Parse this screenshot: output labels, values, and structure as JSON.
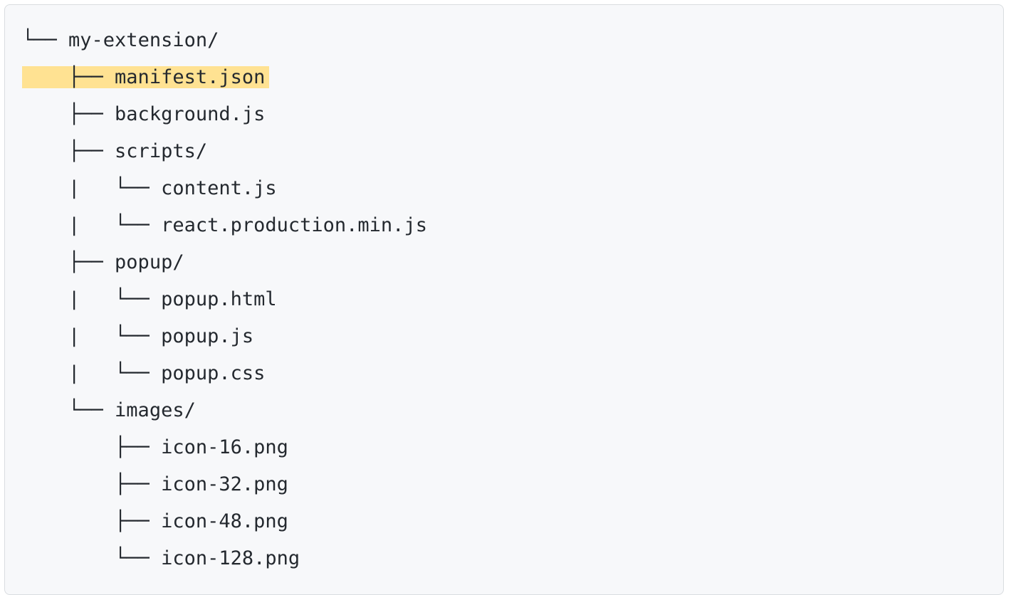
{
  "tree": {
    "lines": [
      {
        "prefix": "└── ",
        "name": "my-extension/",
        "highlighted": false
      },
      {
        "prefix": "    ├── ",
        "name": "manifest.json",
        "highlighted": true
      },
      {
        "prefix": "    ├── ",
        "name": "background.js",
        "highlighted": false
      },
      {
        "prefix": "    ├── ",
        "name": "scripts/",
        "highlighted": false
      },
      {
        "prefix": "    |   └── ",
        "name": "content.js",
        "highlighted": false
      },
      {
        "prefix": "    |   └── ",
        "name": "react.production.min.js",
        "highlighted": false
      },
      {
        "prefix": "    ├── ",
        "name": "popup/",
        "highlighted": false
      },
      {
        "prefix": "    |   └── ",
        "name": "popup.html",
        "highlighted": false
      },
      {
        "prefix": "    |   └── ",
        "name": "popup.js",
        "highlighted": false
      },
      {
        "prefix": "    |   └── ",
        "name": "popup.css",
        "highlighted": false
      },
      {
        "prefix": "    └── ",
        "name": "images/",
        "highlighted": false
      },
      {
        "prefix": "        ├── ",
        "name": "icon-16.png",
        "highlighted": false
      },
      {
        "prefix": "        ├── ",
        "name": "icon-32.png",
        "highlighted": false
      },
      {
        "prefix": "        ├── ",
        "name": "icon-48.png",
        "highlighted": false
      },
      {
        "prefix": "        └── ",
        "name": "icon-128.png",
        "highlighted": false
      }
    ]
  }
}
